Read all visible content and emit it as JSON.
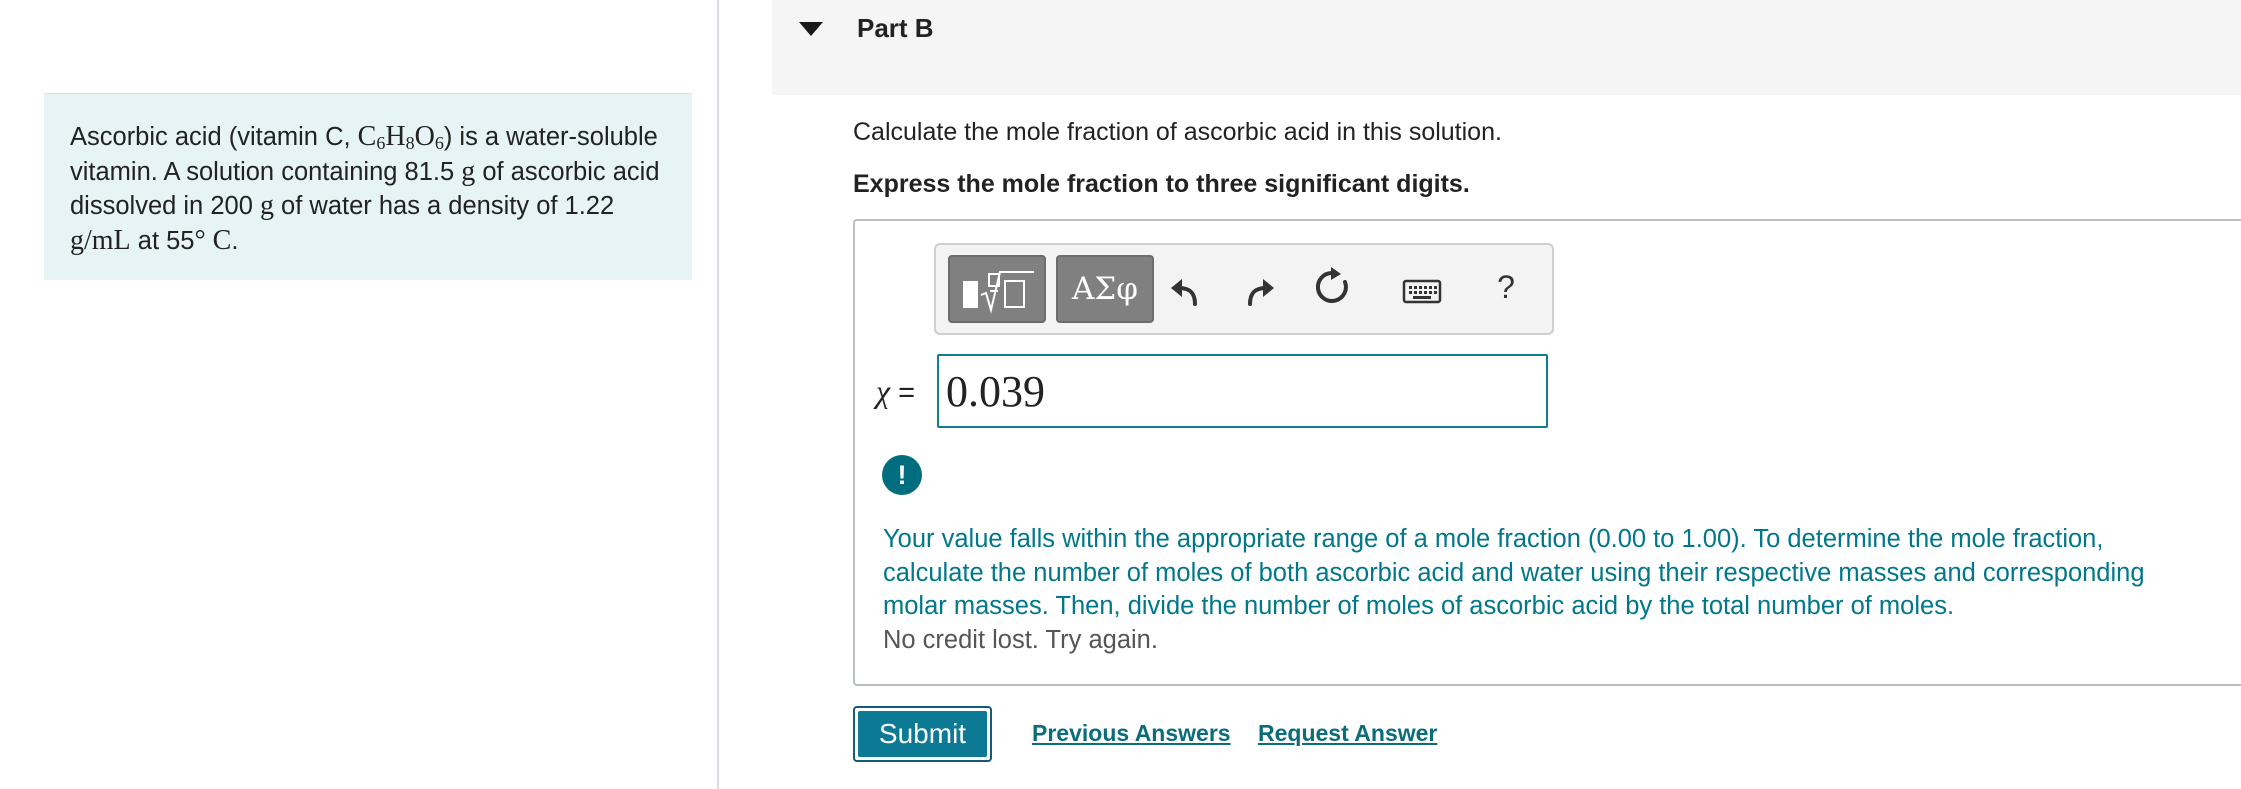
{
  "problem": {
    "text_1": "Ascorbic acid (vitamin C, ",
    "formula": {
      "c": "C",
      "c_sub": "6",
      "h": "H",
      "h_sub": "8",
      "o": "O",
      "o_sub": "6"
    },
    "text_2": ") is a water-soluble vitamin. A solution containing 81.5 ",
    "unit_g": "g",
    "text_3": " of ascorbic acid dissolved in 200 ",
    "text_4": " of water has a density of 1.22 ",
    "density_unit": "g/mL",
    "text_5": " at 55",
    "temp_unit": "° C",
    "text_6": "."
  },
  "part": {
    "title": "Part B"
  },
  "question": {
    "prompt": "Calculate the mole fraction of ascorbic acid in this solution.",
    "instruction": "Express the mole fraction to three significant digits."
  },
  "toolbar": {
    "symbols_label": "ΑΣφ",
    "help_label": "?"
  },
  "answer": {
    "variable": "χ",
    "equals": " =",
    "value": "0.039"
  },
  "alert": {
    "symbol": "!"
  },
  "feedback": {
    "message": "Your value falls within the appropriate range of a mole fraction (0.00 to 1.00). To determine the mole fraction, calculate the number of moles of both ascorbic acid and water using their respective masses and corresponding molar masses. Then, divide the number of moles of ascorbic acid by the total number of moles.",
    "status": "No credit lost. Try again."
  },
  "actions": {
    "submit_label": "Submit",
    "previous_answers_label": "Previous Answers",
    "request_answer_label": "Request Answer"
  },
  "colors": {
    "accent": "#00778a",
    "problem_bg": "#e6f4f5",
    "header_bg": "#f5f5f5",
    "button_gray": "#808080"
  }
}
